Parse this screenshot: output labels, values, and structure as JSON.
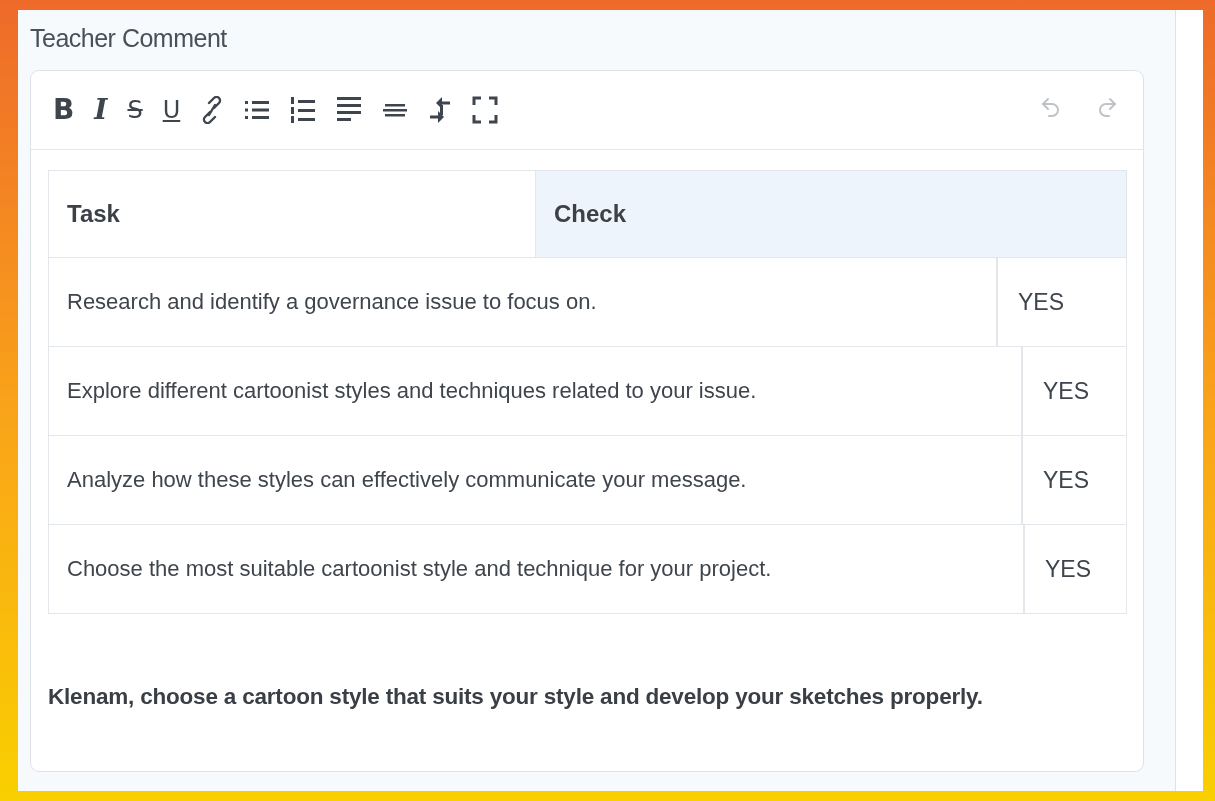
{
  "field_label": "Teacher Comment",
  "toolbar": [
    {
      "kind": "bold",
      "label": "B",
      "disabled": false
    },
    {
      "kind": "italic",
      "label": "I",
      "disabled": false
    },
    {
      "kind": "strike",
      "label": "S",
      "disabled": false
    },
    {
      "kind": "underline",
      "label": "U",
      "disabled": false
    },
    {
      "kind": "link",
      "disabled": false
    },
    {
      "kind": "bullets",
      "disabled": false
    },
    {
      "kind": "numbers",
      "disabled": false
    },
    {
      "kind": "align",
      "disabled": false
    },
    {
      "kind": "rule",
      "disabled": false
    },
    {
      "kind": "arrows",
      "disabled": false
    },
    {
      "kind": "fullscreen",
      "disabled": false
    }
  ],
  "history": [
    {
      "kind": "undo",
      "disabled": true
    },
    {
      "kind": "redo",
      "disabled": true
    }
  ],
  "table": {
    "header_cells": [
      "Task",
      "Check"
    ],
    "rows": [
      [
        "Research and identify a governance issue to focus on.",
        "YES"
      ],
      [
        "Explore different cartoonist styles and techniques related to your issue.",
        "YES"
      ],
      [
        "Analyze how these styles can effectively communicate your message.",
        "YES"
      ],
      [
        "Choose the most suitable cartoonist style and technique for your project.",
        "YES"
      ]
    ]
  },
  "comment": "Klenam, choose a cartoon style that suits your style and develop your sketches properly."
}
